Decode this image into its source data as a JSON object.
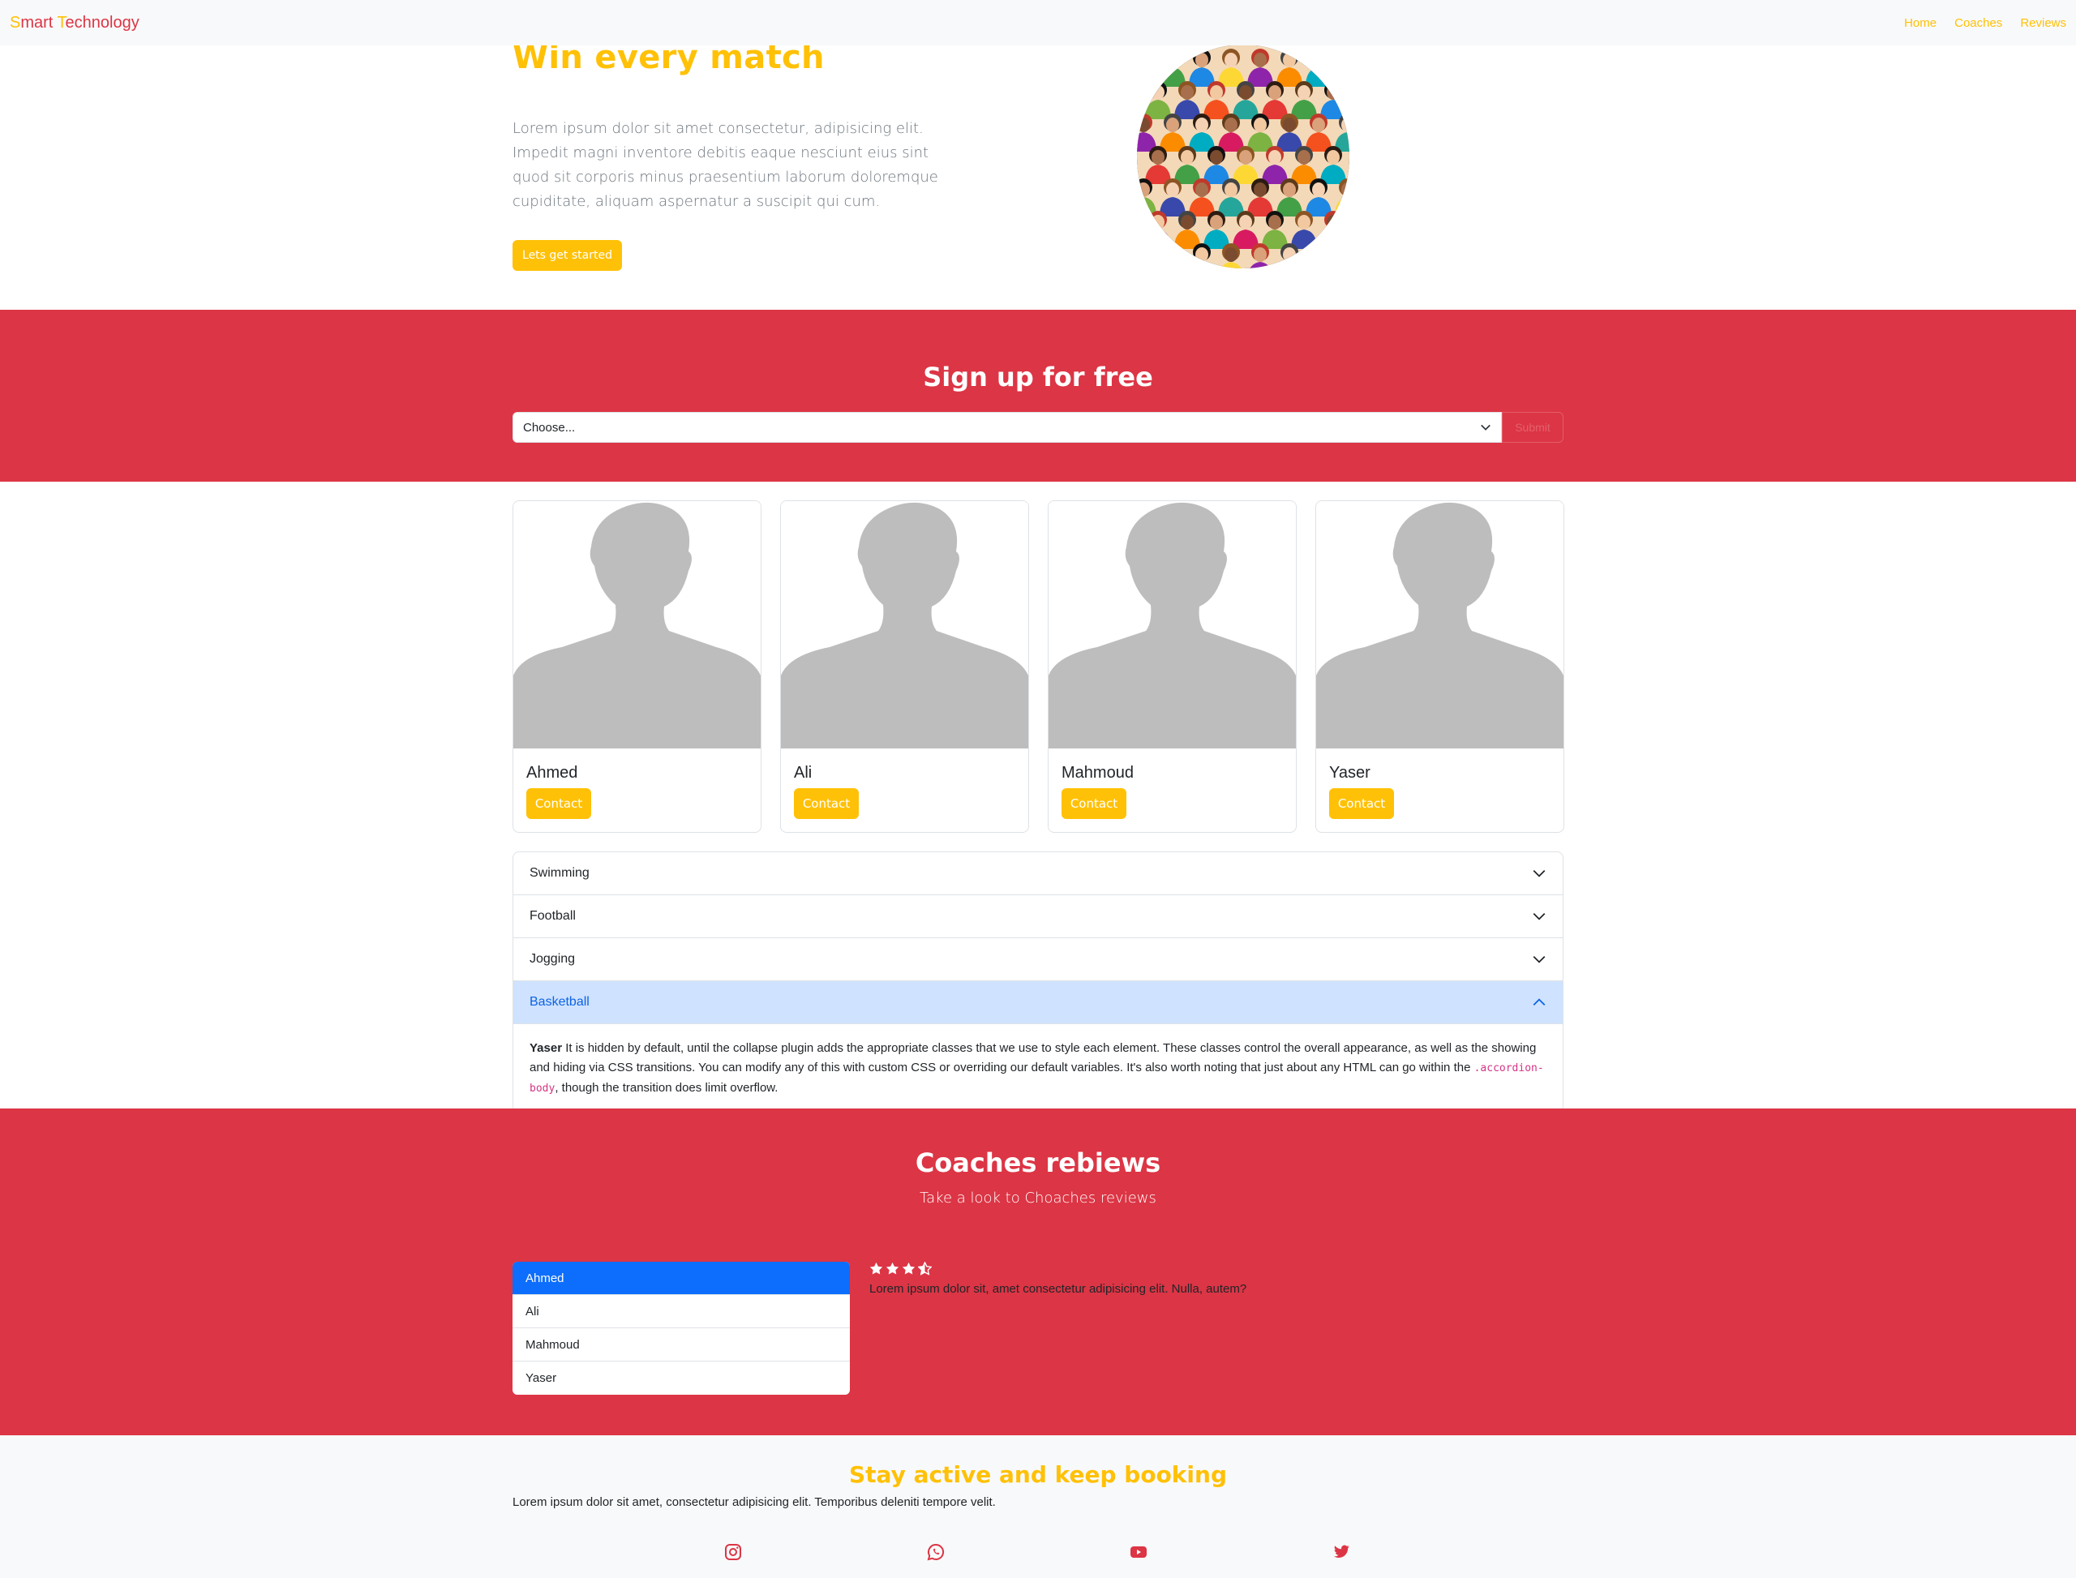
{
  "navbar": {
    "brand_s": "S",
    "brand_mart": "mart ",
    "brand_t": "T",
    "brand_echnology": "echnology",
    "links": [
      "Home",
      "Coaches",
      "Reviews"
    ]
  },
  "hero": {
    "title": "Win every match",
    "text": "Lorem ipsum dolor sit amet consectetur, adipisicing elit. Impedit magni inventore debitis eaque nesciunt eius sint quod sit corporis minus praesentium laborum doloremque cupiditate, aliquam aspernatur a suscipit qui cum.",
    "button": "Lets get started"
  },
  "signup": {
    "title": "Sign up for free",
    "select_value": "Choose...",
    "submit": "Submit"
  },
  "coaches": [
    {
      "name": "Ahmed",
      "button": "Contact"
    },
    {
      "name": "Ali",
      "button": "Contact"
    },
    {
      "name": "Mahmoud",
      "button": "Contact"
    },
    {
      "name": "Yaser",
      "button": "Contact"
    }
  ],
  "accordion": {
    "items": [
      "Swimming",
      "Football",
      "Jogging",
      "Basketball"
    ],
    "body_strong": "Yaser",
    "body_text_1": " It is hidden by default, until the collapse plugin adds the appropriate classes that we use to style each element. These classes control the overall appearance, as well as the showing and hiding via CSS transitions. You can modify any of this with custom CSS or overriding our default variables. It's also worth noting that just about any HTML can go within the ",
    "body_code": ".accordion-body",
    "body_text_2": ", though the transition does limit overflow."
  },
  "reviews": {
    "title": "Coaches rebiews",
    "subtitle": "Take a look to Choaches reviews",
    "list": [
      "Ahmed",
      "Ali",
      "Mahmoud",
      "Yaser"
    ],
    "rating": 3.5,
    "text": "Lorem ipsum dolor sit, amet consectetur adipisicing elit. Nulla, autem?"
  },
  "footer": {
    "title": "Stay active and keep booking",
    "text": "Lorem ipsum dolor sit amet, consectetur adipisicing elit. Temporibus deleniti tempore velit.",
    "icons": [
      "instagram-icon",
      "whatsapp-icon",
      "youtube-icon",
      "twitter-icon"
    ]
  },
  "colors": {
    "primary_red": "#dc3545",
    "accent_yellow": "#ffc107",
    "active_blue": "#0d6efd",
    "light_bg": "#f8f9fa"
  }
}
